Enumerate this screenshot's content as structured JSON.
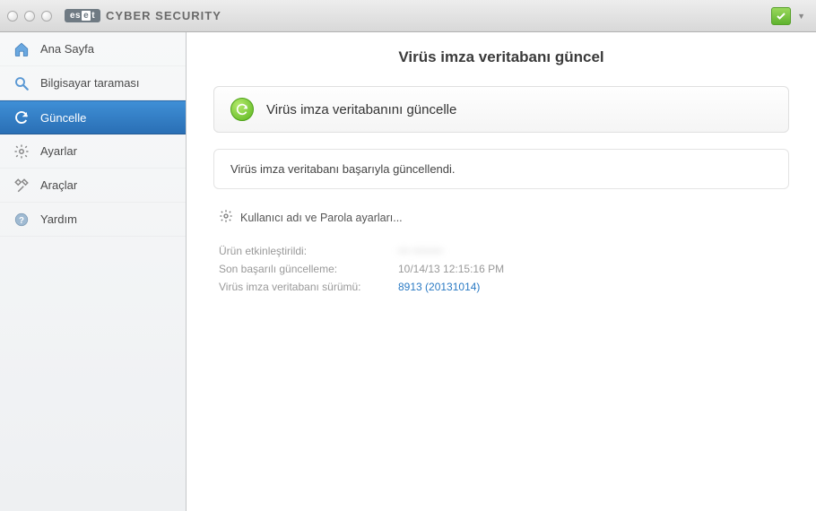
{
  "brand": {
    "logo": "eset",
    "name": "CYBER SECURITY"
  },
  "sidebar": {
    "items": [
      {
        "label": "Ana Sayfa"
      },
      {
        "label": "Bilgisayar taraması"
      },
      {
        "label": "Güncelle"
      },
      {
        "label": "Ayarlar"
      },
      {
        "label": "Araçlar"
      },
      {
        "label": "Yardım"
      }
    ]
  },
  "content": {
    "title": "Virüs imza veritabanı güncel",
    "update_button": "Virüs imza veritabanını güncelle",
    "status_message": "Virüs imza veritabanı başarıyla güncellendi.",
    "settings_link": "Kullanıcı adı ve Parola ayarları...",
    "info": {
      "activated": {
        "label": "Ürün etkinleştirildi:",
        "value": "••• ••••••••"
      },
      "last_update": {
        "label": "Son başarılı güncelleme:",
        "value": "10/14/13 12:15:16 PM"
      },
      "db_version": {
        "label": "Virüs imza veritabanı sürümü:",
        "value": "8913 (20131014)"
      }
    }
  }
}
